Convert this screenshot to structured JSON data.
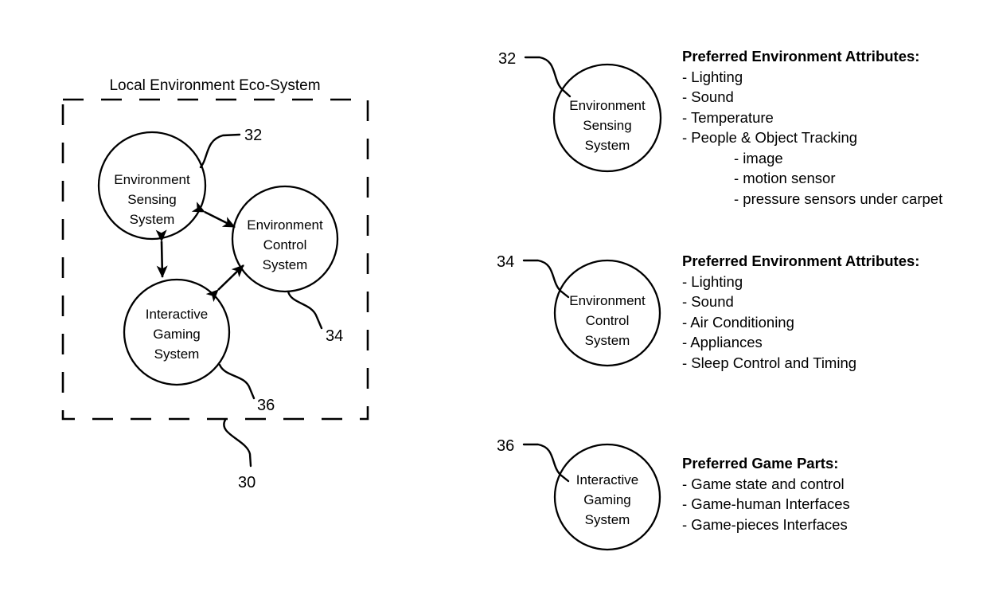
{
  "figure": {
    "group_title": "Local Environment Eco-System",
    "group_ref": "30",
    "left_diagram": {
      "nodes": [
        {
          "id": "sensing",
          "label_lines": [
            "Environment",
            "Sensing",
            "System"
          ],
          "ref": "32"
        },
        {
          "id": "control",
          "label_lines": [
            "Environment",
            "Control",
            "System"
          ],
          "ref": "34"
        },
        {
          "id": "gaming",
          "label_lines": [
            "Interactive",
            "Gaming",
            "System"
          ],
          "ref": "36"
        }
      ],
      "connections": [
        {
          "from": "sensing",
          "to": "control",
          "style": "double-arrow"
        },
        {
          "from": "sensing",
          "to": "gaming",
          "style": "double-arrow"
        },
        {
          "from": "gaming",
          "to": "control",
          "style": "double-arrow"
        }
      ]
    },
    "panels": [
      {
        "ref": "32",
        "node_label_lines": [
          "Environment",
          "Sensing",
          "System"
        ],
        "heading": "Preferred Environment Attributes:",
        "items": [
          {
            "text": "- Lighting",
            "indent": 0
          },
          {
            "text": "- Sound",
            "indent": 0
          },
          {
            "text": "- Temperature",
            "indent": 0
          },
          {
            "text": "- People & Object Tracking",
            "indent": 0
          },
          {
            "text": "- image",
            "indent": 1
          },
          {
            "text": "- motion sensor",
            "indent": 1
          },
          {
            "text": "- pressure sensors under carpet",
            "indent": 1
          }
        ]
      },
      {
        "ref": "34",
        "node_label_lines": [
          "Environment",
          "Control",
          "System"
        ],
        "heading": "Preferred Environment Attributes:",
        "items": [
          {
            "text": "- Lighting",
            "indent": 0
          },
          {
            "text": "- Sound",
            "indent": 0
          },
          {
            "text": "- Air Conditioning",
            "indent": 0
          },
          {
            "text": "- Appliances",
            "indent": 0
          },
          {
            "text": "- Sleep Control and Timing",
            "indent": 0
          }
        ]
      },
      {
        "ref": "36",
        "node_label_lines": [
          "Interactive",
          "Gaming",
          "System"
        ],
        "heading": "Preferred Game Parts:",
        "items": [
          {
            "text": "- Game state and control",
            "indent": 0
          },
          {
            "text": "- Game-human Interfaces",
            "indent": 0
          },
          {
            "text": "- Game-pieces Interfaces",
            "indent": 0
          }
        ]
      }
    ],
    "colors": {
      "ink": "#000000",
      "background": "#ffffff"
    }
  }
}
